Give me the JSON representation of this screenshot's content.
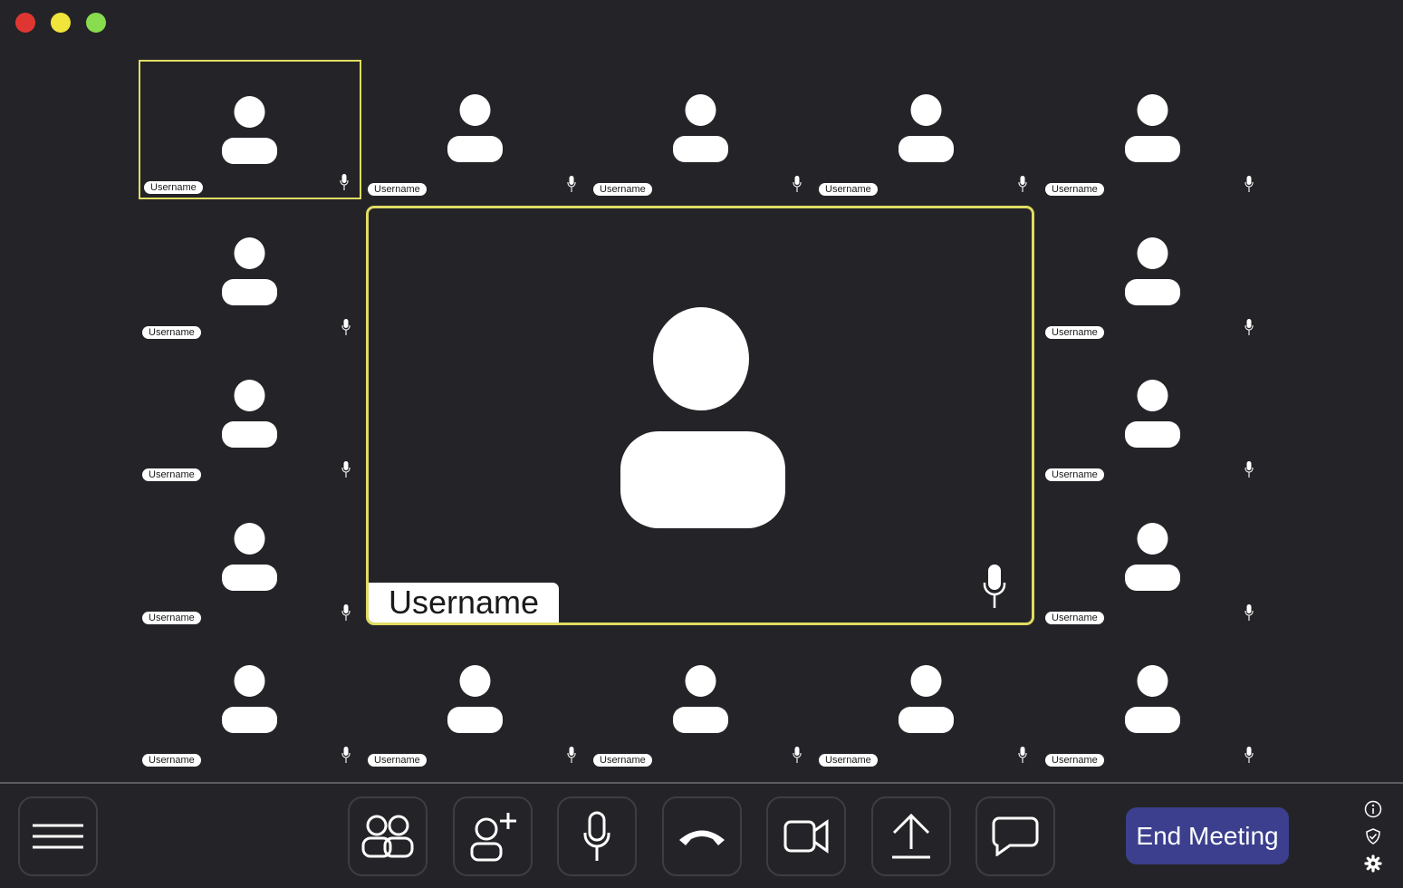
{
  "window": {
    "controls": [
      "close",
      "minimize",
      "maximize"
    ],
    "colors": {
      "close": "#e03632",
      "minimize": "#f1e43a",
      "maximize": "#88dc4e"
    }
  },
  "participants": [
    {
      "name": "Username",
      "active": true
    },
    {
      "name": "Username"
    },
    {
      "name": "Username"
    },
    {
      "name": "Username"
    },
    {
      "name": "Username"
    },
    {
      "name": "Username"
    },
    {
      "name": "Username"
    },
    {
      "name": "Username"
    },
    {
      "name": "Username"
    },
    {
      "name": "Username"
    },
    {
      "name": "Username"
    },
    {
      "name": "Username"
    },
    {
      "name": "Username"
    },
    {
      "name": "Username"
    },
    {
      "name": "Username"
    },
    {
      "name": "Username"
    }
  ],
  "main_speaker": {
    "name": "Username",
    "icon": "microphone-icon"
  },
  "toolbar": {
    "menu_icon": "hamburger-menu-icon",
    "buttons": [
      {
        "icon": "participants-icon"
      },
      {
        "icon": "add-user-icon"
      },
      {
        "icon": "microphone-icon"
      },
      {
        "icon": "hang-up-icon"
      },
      {
        "icon": "video-camera-icon"
      },
      {
        "icon": "share-screen-icon"
      },
      {
        "icon": "chat-icon"
      }
    ],
    "end_meeting_label": "End Meeting",
    "side_icons": [
      "info-icon",
      "security-shield-icon",
      "settings-gear-icon"
    ]
  },
  "colors": {
    "background": "#242428",
    "highlight": "#e0dc63",
    "end_button": "#3b3f8e",
    "label_bg": "#ffffff"
  }
}
